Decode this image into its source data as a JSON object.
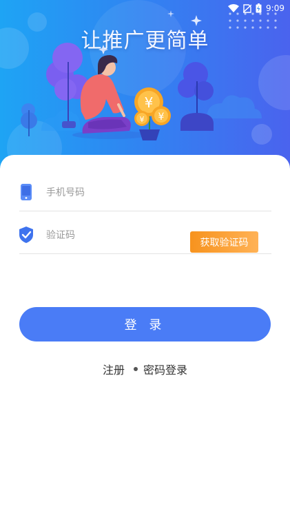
{
  "status_bar": {
    "time": "9:09"
  },
  "hero": {
    "title": "让推广更简单"
  },
  "form": {
    "phone_placeholder": "手机号码",
    "code_placeholder": "验证码",
    "get_code_label": "获取验证码"
  },
  "login_button": "登 录",
  "links": {
    "register": "注册",
    "password_login": "密码登录"
  },
  "colors": {
    "primary": "#4a7cf6",
    "accent_orange": "#f7931e",
    "hero_gradient_start": "#1ea4f4",
    "hero_gradient_end": "#4a63ee"
  }
}
